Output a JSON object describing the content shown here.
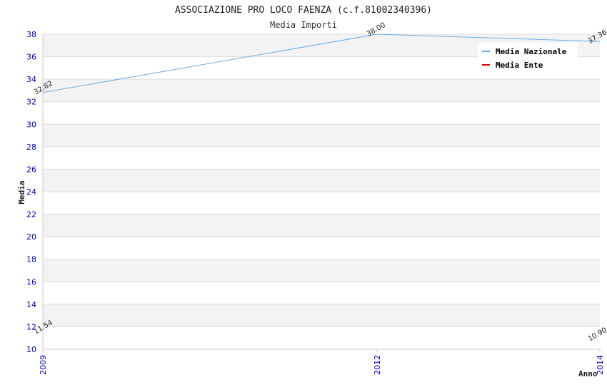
{
  "chart_data": {
    "type": "line",
    "title": "ASSOCIAZIONE PRO LOCO FAENZA (c.f.81002340396)",
    "subtitle": "Media Importi",
    "xlabel": "Anno",
    "ylabel": "Media",
    "x": [
      "2009",
      "2012",
      "2014"
    ],
    "ylim": [
      10,
      38
    ],
    "yticks": [
      "10",
      "12",
      "14",
      "16",
      "18",
      "20",
      "22",
      "24",
      "26",
      "28",
      "30",
      "32",
      "34",
      "36",
      "38"
    ],
    "grid": true,
    "legend_position": "top-right",
    "series": [
      {
        "name": "Media Nazionale",
        "color": "#6aaee8",
        "values": [
          32.82,
          38.0,
          37.36
        ],
        "labels": [
          "32.82",
          "38.00",
          "37.36"
        ]
      },
      {
        "name": "Media Ente",
        "color": "#dd0000",
        "values": [
          11.54,
          null,
          10.9
        ],
        "labels": [
          "11.54",
          "",
          "10.90"
        ]
      }
    ]
  }
}
